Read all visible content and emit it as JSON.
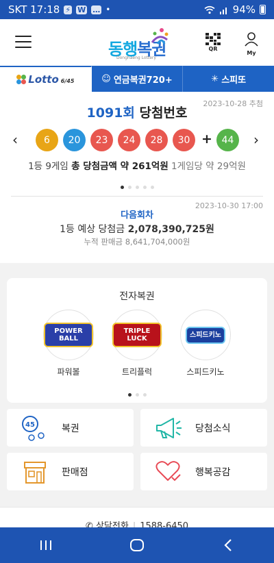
{
  "status_bar": {
    "carrier_time": "SKT 17:18",
    "app_icons": [
      "bolt-icon",
      "wow-icon",
      "chat-icon"
    ],
    "dot": "•",
    "battery": "94%",
    "icons": [
      "wifi-icon",
      "signal-icon",
      "battery-icon"
    ]
  },
  "header": {
    "logo_text_1": "동행",
    "logo_text_2": "복권",
    "logo_subtitle": "Donghaeng Lottery",
    "qr_label": "QR",
    "my_label": "My"
  },
  "tabs": [
    {
      "label": "Lotto",
      "sub": "6/45",
      "active": true
    },
    {
      "label": "연금복권720+",
      "active": false
    },
    {
      "label": "스피또",
      "active": false
    }
  ],
  "result": {
    "draw_number": "1091회",
    "title_suffix": " 당첨번호",
    "draw_date": "2023-10-28 추첨",
    "numbers": [
      6,
      20,
      23,
      24,
      28,
      30
    ],
    "bonus": 44,
    "plus": "+",
    "prev_arrow": "‹",
    "next_arrow": "›",
    "prize_prefix": "1등 9게임 ",
    "prize_strong": "총 당첨금액 약 261억원",
    "prize_per_game": " 1게임당 약 29억원",
    "slide_count": 5,
    "active_slide": 0
  },
  "next_draw": {
    "title": "다음회차",
    "date": "2023-10-30 17:00",
    "prize_label": "1등 예상 당첨금 ",
    "prize_amount": "2,078,390,725원",
    "sales": "누적 판매금 8,641,704,000원"
  },
  "e_lottery": {
    "title": "전자복권",
    "games": [
      {
        "label": "파워볼",
        "badge": "POWER BALL",
        "color": "#2a3fa8"
      },
      {
        "label": "트리플럭",
        "badge": "TRIPLE LUCK",
        "color": "#b8121b"
      },
      {
        "label": "스피드키노",
        "badge": "스피드키노",
        "color": "#1b3f9e"
      }
    ],
    "slide_count": 3,
    "active_slide": 0
  },
  "menu": {
    "lottery": "복권",
    "lottery_badge": "45",
    "news": "당첨소식",
    "shop": "판매점",
    "happy": "행복공감"
  },
  "footer": {
    "label": "상담전화",
    "phone": "1588-6450"
  },
  "nav": [
    "recent-apps-icon",
    "home-icon",
    "back-icon"
  ],
  "colors": {
    "brand_blue": "#1e63c4",
    "status_blue": "#1e54b2",
    "ball_yellow": "#e8a516",
    "ball_blue": "#2a95dc",
    "ball_red": "#e8574f",
    "ball_green": "#56b44a",
    "menu_teal": "#20b6a6",
    "menu_red": "#e84a55",
    "menu_orange": "#e3962b"
  }
}
